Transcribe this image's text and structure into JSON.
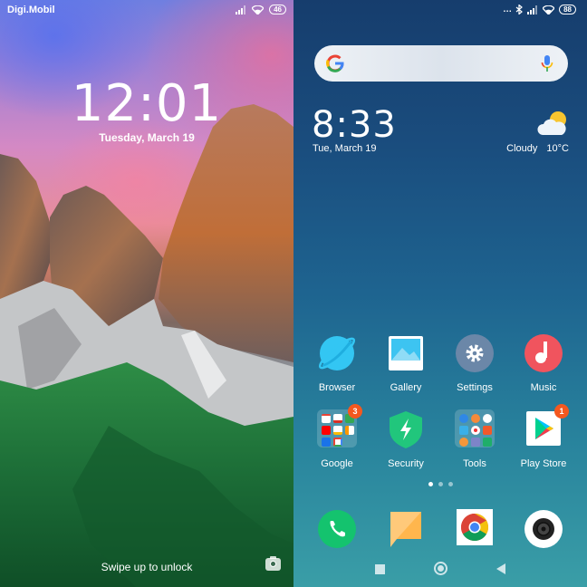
{
  "lock_screen": {
    "status_bar": {
      "carrier": "Digi.Mobil",
      "battery": "46"
    },
    "time": "12:01",
    "date": "Tuesday, March 19",
    "unlock_hint": "Swipe up to unlock",
    "camera_shortcut_icon": "camera-icon"
  },
  "home_screen": {
    "status_bar": {
      "more_icon": "…",
      "bluetooth_icon": "bluetooth-icon",
      "battery": "88"
    },
    "search": {
      "logo": "G"
    },
    "clock": {
      "time": "8:33",
      "date": "Tue, March 19"
    },
    "weather": {
      "condition": "Cloudy",
      "temperature": "10°C"
    },
    "apps_row1": [
      {
        "label": "Browser"
      },
      {
        "label": "Gallery"
      },
      {
        "label": "Settings"
      },
      {
        "label": "Music"
      }
    ],
    "apps_row2": [
      {
        "label": "Google",
        "badge": "3"
      },
      {
        "label": "Security"
      },
      {
        "label": "Tools"
      },
      {
        "label": "Play Store",
        "badge": "1"
      }
    ],
    "page_indicator": {
      "pages": 3,
      "current": 1
    },
    "dock": [
      "Phone",
      "Messages",
      "Chrome",
      "Camera"
    ],
    "colors": {
      "badge": "#f4581f",
      "phone": "#14c36e",
      "music": "#f0545e",
      "security": "#21c67c",
      "browser": "#33c6f3"
    }
  }
}
